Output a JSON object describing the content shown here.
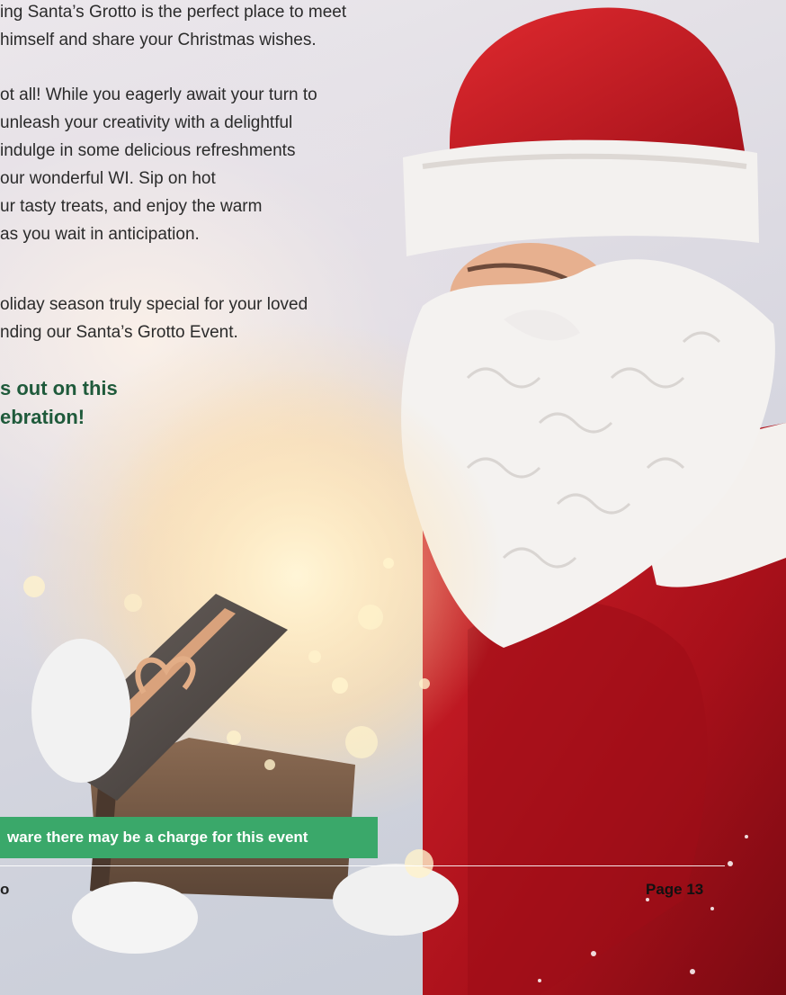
{
  "body": {
    "paragraph_1": "ing Santa’s Grotto is the perfect place to meet\n himself and share your Christmas wishes.",
    "paragraph_2": "ot all! While you eagerly await your turn to\nunleash your creativity with a delightful\nindulge in some delicious refreshments\n our wonderful WI. Sip on hot\nur tasty treats, and enjoy the warm\n as you wait in anticipation.",
    "paragraph_3": "oliday season truly special for your loved\nnding our Santa’s Grotto Event.",
    "callout": "s out on this\nebration!"
  },
  "notice": {
    "text": "ware there may be a charge for this event",
    "color": "#3aa86a"
  },
  "footer": {
    "left_text": "o",
    "page_label": "Page 13"
  },
  "colors": {
    "callout": "#1f5a3b",
    "santa_red": "#b5121b"
  }
}
